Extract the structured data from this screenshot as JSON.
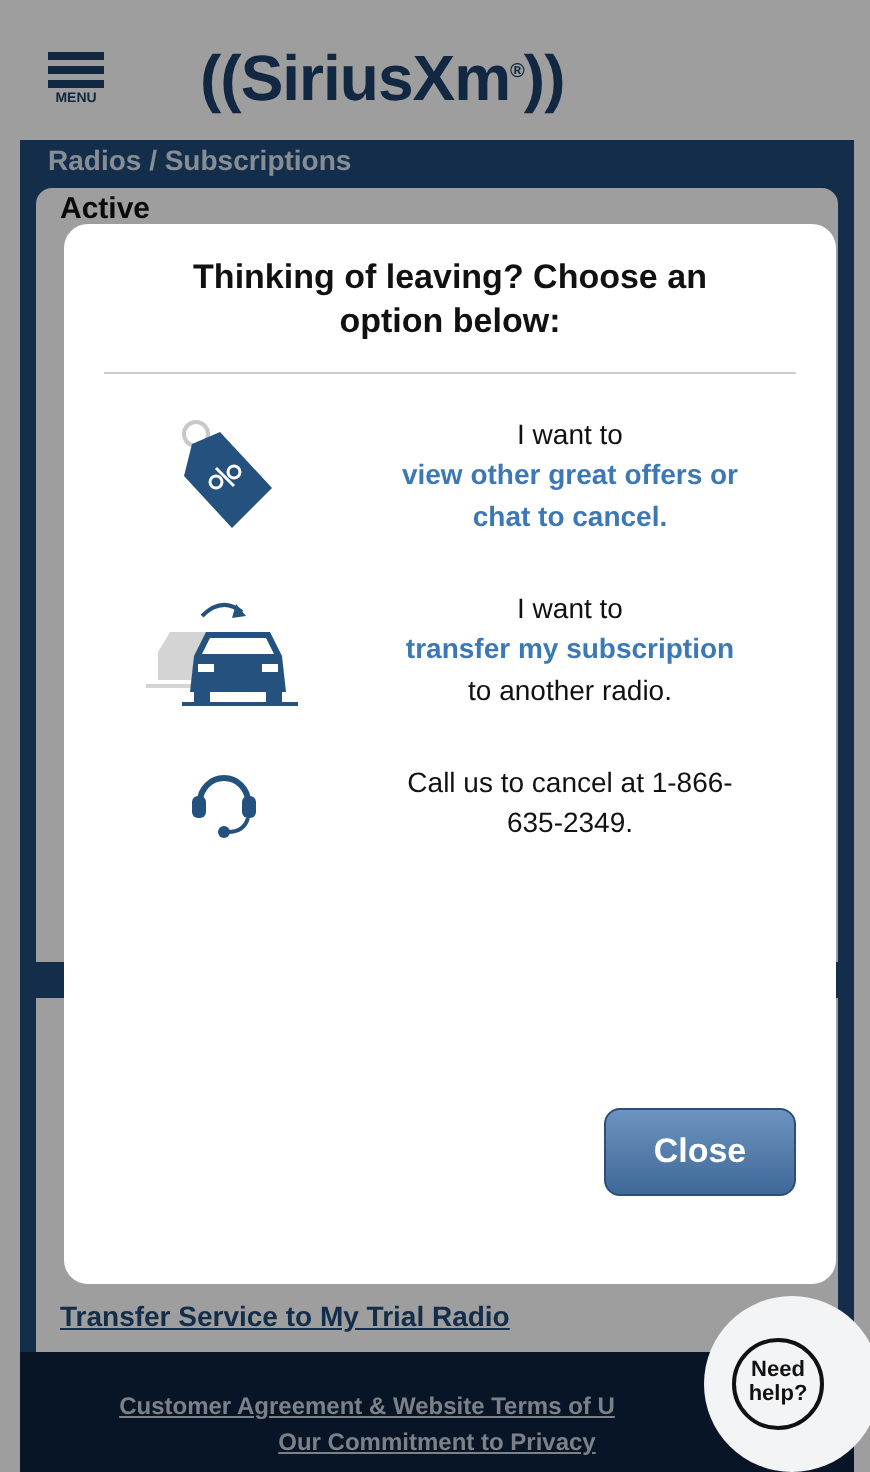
{
  "header": {
    "menu_label": "MENU",
    "logo": "((SiriusXm$^{®}$))"
  },
  "section_title": "Radios / Subscriptions",
  "card": {
    "status": "Active",
    "link": "Transfer Service to My Trial Radio"
  },
  "modal": {
    "title": "Thinking of leaving? Choose an option below:",
    "options": [
      {
        "kind": "tag",
        "prefix": "I want to",
        "link": "view other great offers or chat to cancel."
      },
      {
        "kind": "cars",
        "prefix": "I want to",
        "link": "transfer my subscription",
        "suffix": "to another radio."
      },
      {
        "kind": "headset",
        "prefix": "Call us to cancel at 1-866-635-2349."
      }
    ],
    "close_button": "Close"
  },
  "help_bubble": "Need help?",
  "footer": {
    "links": [
      "Customer Agreement & Website Terms of U",
      "Our Commitment to Privacy"
    ]
  }
}
